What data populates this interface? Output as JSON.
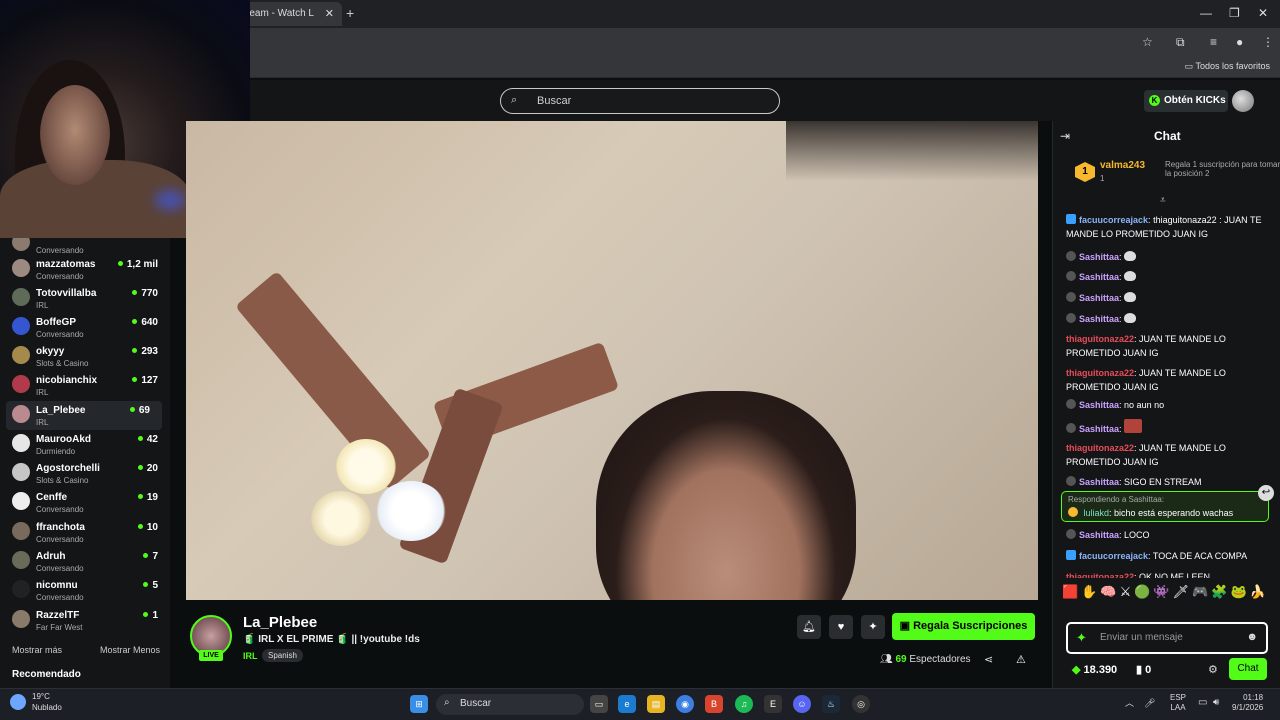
{
  "browser": {
    "tab_title": "ream - Watch L",
    "bookmarks_label": "Todos los favoritos"
  },
  "header": {
    "search_placeholder": "Buscar",
    "kicks_button": "Obtén KICKs"
  },
  "sidebar": {
    "channels": [
      {
        "name": "",
        "category": "Conversando",
        "viewers": "",
        "color": "#8a7a70"
      },
      {
        "name": "mazzatomas",
        "category": "Conversando",
        "viewers": "1,2 mil",
        "color": "#9c8a80"
      },
      {
        "name": "Totovvillalba",
        "category": "IRL",
        "viewers": "770",
        "color": "#5d6b58"
      },
      {
        "name": "BoffeGP",
        "category": "Conversando",
        "viewers": "640",
        "color": "#3456d0"
      },
      {
        "name": "okyyy",
        "category": "Slots & Casino",
        "viewers": "293",
        "color": "#a68a4c"
      },
      {
        "name": "nicobianchix",
        "category": "IRL",
        "viewers": "127",
        "color": "#b03a4a"
      },
      {
        "name": "La_Plebee",
        "category": "IRL",
        "viewers": "69",
        "color": "#b98a90"
      },
      {
        "name": "MaurooAkd",
        "category": "Durmiendo",
        "viewers": "42",
        "color": "#e6e6e6"
      },
      {
        "name": "Agostorchelli",
        "category": "Slots & Casino",
        "viewers": "20",
        "color": "#c6c6c6"
      },
      {
        "name": "Cenffe",
        "category": "Conversando",
        "viewers": "19",
        "color": "#eeeeee"
      },
      {
        "name": "ffranchota",
        "category": "Conversando",
        "viewers": "10",
        "color": "#7a6a5c"
      },
      {
        "name": "Adruh",
        "category": "Conversando",
        "viewers": "7",
        "color": "#6a6a5a"
      },
      {
        "name": "nicomnu",
        "category": "Conversando",
        "viewers": "5",
        "color": "#222222"
      },
      {
        "name": "RazzelTF",
        "category": "Far Far West",
        "viewers": "1",
        "color": "#8a7a6a"
      }
    ],
    "show_more": "Mostrar más",
    "show_less": "Mostrar Menos",
    "recommended": "Recomendado"
  },
  "stream": {
    "name": "La_Plebee",
    "title": "🧃 IRL X EL PRIME 🧃 || !youtube !ds",
    "category": "IRL",
    "tag": "Spanish",
    "live_label": "LIVE",
    "gift_button": "Regala Suscripciones",
    "viewers_count": "69",
    "viewers_label": "Espectadores"
  },
  "chat": {
    "title": "Chat",
    "pinned": {
      "rank": "1",
      "user": "valma243",
      "count": "1",
      "cta": "Regala 1 suscripción para tomar la posición 2"
    },
    "messages": [
      {
        "user": "facuucorreajack",
        "text": "thiaguitonaza22 : JUAN TE MANDE LO PROMETIDO JUAN IG"
      },
      {
        "user": "Sashittaa",
        "text": ""
      },
      {
        "user": "Sashittaa",
        "text": ""
      },
      {
        "user": "Sashittaa",
        "text": ""
      },
      {
        "user": "Sashittaa",
        "text": ""
      },
      {
        "user": "thiaguitonaza22",
        "text": "JUAN TE MANDE LO PROMETIDO JUAN IG"
      },
      {
        "user": "thiaguitonaza22",
        "text": "JUAN TE MANDE LO PROMETIDO JUAN IG"
      },
      {
        "user": "Sashittaa",
        "text": "no aun no"
      },
      {
        "user": "Sashittaa",
        "text": ""
      },
      {
        "user": "thiaguitonaza22",
        "text": "JUAN TE MANDE LO PROMETIDO JUAN IG"
      },
      {
        "user": "Sashittaa",
        "text": "SIGO EN STREAM"
      },
      {
        "user": "Sashittaa",
        "text": "LOCO"
      },
      {
        "user": "facuucorreajack",
        "text": "TOCA DE ACA COMPA"
      },
      {
        "user": "thiaguitonaza22",
        "text": "OK NO ME LEEN"
      }
    ],
    "reply": {
      "context": "Respondiendo a Sashittaa:",
      "user": "luliakd",
      "text": "bicho está esperando wachas"
    },
    "input_placeholder": "Enviar un mensaje",
    "kicks_balance": "18.390",
    "subs_balance": "0",
    "send_button": "Chat"
  },
  "taskbar": {
    "temperature": "19°C",
    "weather": "Nublado",
    "search": "Buscar",
    "lang_top": "ESP",
    "lang_bottom": "LAA",
    "time": "01:18",
    "date": "9/1/2026"
  }
}
